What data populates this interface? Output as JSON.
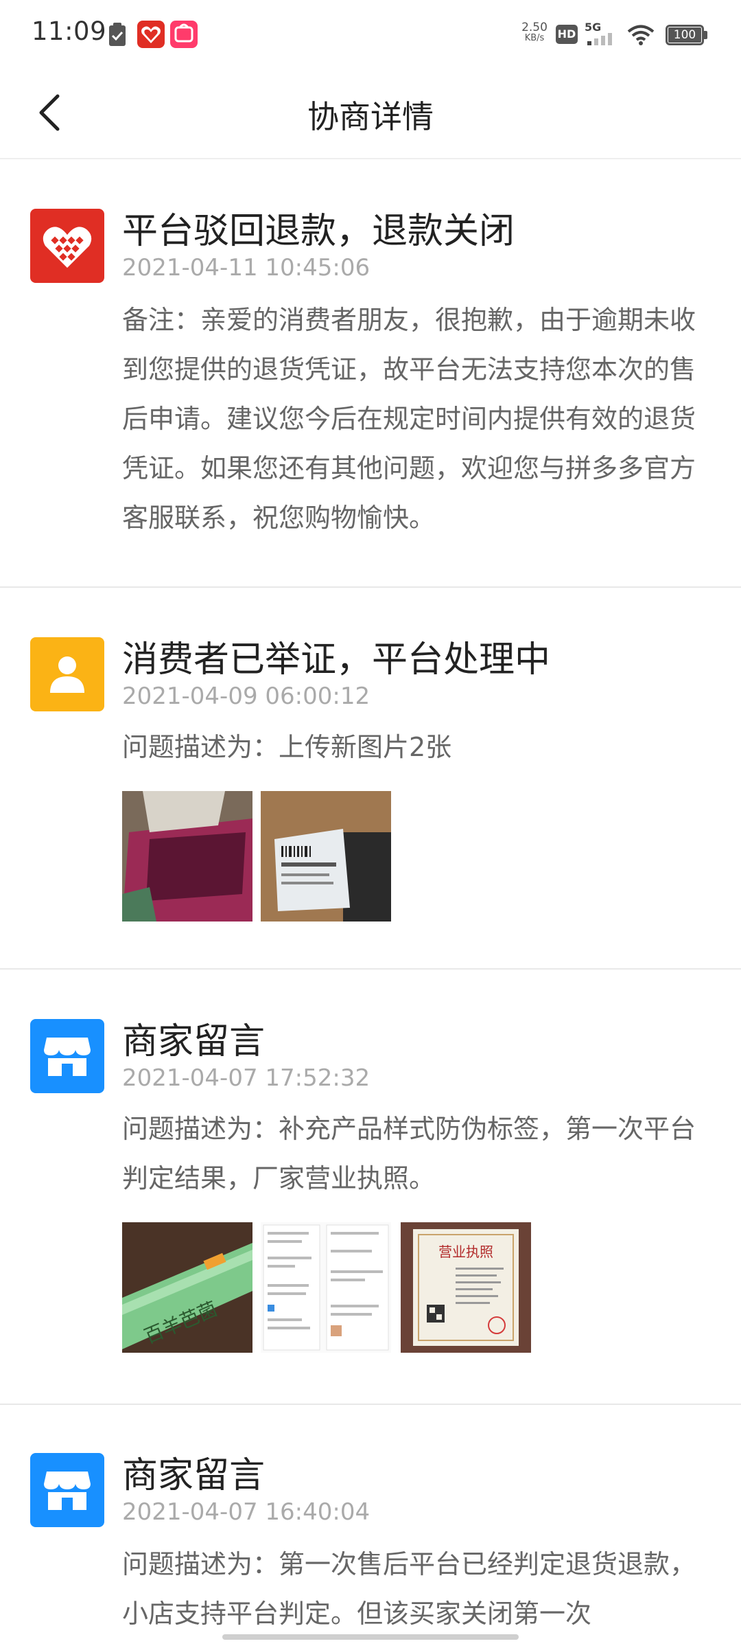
{
  "status_bar": {
    "time": "11:09",
    "net_speed_value": "2.50",
    "net_speed_unit": "KB/s",
    "hd": "HD",
    "network": "5G",
    "battery": "100"
  },
  "nav": {
    "title": "协商详情"
  },
  "entries": [
    {
      "icon": "pinduoduo-logo-icon",
      "color": "#e02e24",
      "title": "平台驳回退款，退款关闭",
      "time": "2021-04-11 10:45:06",
      "description": "备注：亲爱的消费者朋友，很抱歉，由于逾期未收到您提供的退货凭证，故平台无法支持您本次的售后申请。建议您今后在规定时间内提供有效的退货凭证。如果您还有其他问题，欢迎您与拼多多官方客服联系，祝您购物愉快。"
    },
    {
      "icon": "consumer-user-icon",
      "color": "#fbb315",
      "title": "消费者已举证，平台处理中",
      "time": "2021-04-09 06:00:12",
      "description": "问题描述为：上传新图片2张"
    },
    {
      "icon": "merchant-store-icon",
      "color": "#1890ff",
      "title": "商家留言",
      "time": "2021-04-07 17:52:32",
      "description": "问题描述为：补充产品样式防伪标签，第一次平台判定结果，厂家营业执照。",
      "photo_texts": [
        "百羊芭菌",
        "营业执照"
      ]
    },
    {
      "icon": "merchant-store-icon",
      "color": "#1890ff",
      "title": "商家留言",
      "time": "2021-04-07 16:40:04",
      "description": "问题描述为：第一次售后平台已经判定退货退款，小店支持平台判定。但该买家关闭第一次"
    }
  ]
}
